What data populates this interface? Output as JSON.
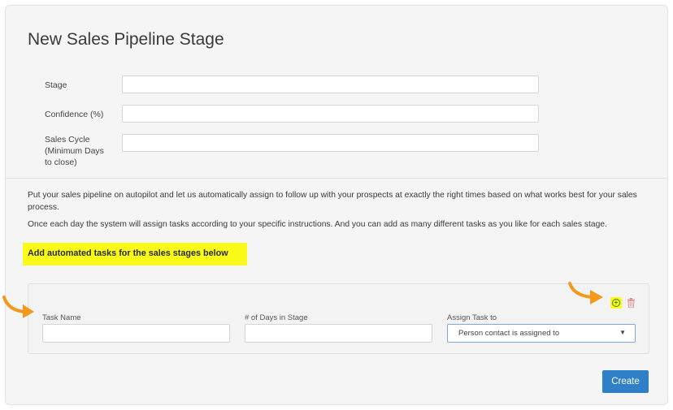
{
  "form": {
    "title": "New Sales Pipeline Stage",
    "fields": [
      {
        "label": "Stage",
        "value": ""
      },
      {
        "label": "Confidence (%)",
        "value": ""
      },
      {
        "label_lines": [
          "Sales Cycle",
          "(Minimum Days",
          "to close)"
        ],
        "value": ""
      }
    ]
  },
  "automation": {
    "intro": "Put your sales pipeline on autopilot and let us automatically assign to follow up with your prospects at exactly the right times based on what works best for your sales process.",
    "details": "Once each day the system will assign tasks according to your specific instructions. And you can add as many different tasks as you like for each sales stage.",
    "highlight": "Add automated tasks for the sales stages below"
  },
  "task_row": {
    "task_name_label": "Task Name",
    "task_name_value": "",
    "days_label": "# of Days in Stage",
    "days_value": "",
    "assign_label": "Assign Task to",
    "assign_selected": "Person contact is assigned to"
  },
  "actions": {
    "create_label": "Create"
  },
  "icons": {
    "add": "add-circle-icon",
    "delete": "trash-icon",
    "pointer": "arrow-pointer-icon"
  },
  "colors": {
    "highlight": "#fbfb1a",
    "primary_button": "#2f80c6",
    "arrow": "#f39a1c",
    "add_icon": "#3a7d1a",
    "delete_icon": "#e88a8a"
  }
}
